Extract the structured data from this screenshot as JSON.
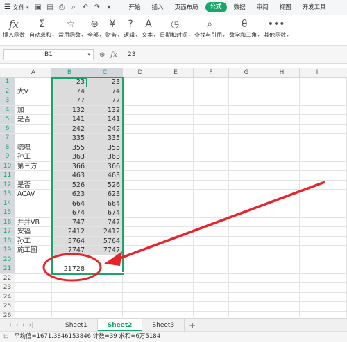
{
  "menubar": {
    "file_label": "文件",
    "tabs": [
      "开始",
      "插入",
      "页面布局",
      "公式",
      "数据",
      "审阅",
      "视图",
      "开发工具"
    ],
    "active_tab": "公式"
  },
  "ribbon": [
    {
      "icon": "fx",
      "label": "插入函数",
      "has_dropdown": false
    },
    {
      "icon": "Σ",
      "label": "自动求和",
      "has_dropdown": true
    },
    {
      "icon": "☆",
      "label": "常用函数",
      "has_dropdown": true
    },
    {
      "icon": "⊛",
      "label": "全部",
      "has_dropdown": true
    },
    {
      "icon": "¥",
      "label": "财务",
      "has_dropdown": true
    },
    {
      "icon": "?",
      "label": "逻辑",
      "has_dropdown": true
    },
    {
      "icon": "A",
      "label": "文本",
      "has_dropdown": true
    },
    {
      "icon": "◷",
      "label": "日期和时间",
      "has_dropdown": true
    },
    {
      "icon": "⌕",
      "label": "查找与引用",
      "has_dropdown": true
    },
    {
      "icon": "θ",
      "label": "数学和三角",
      "has_dropdown": true
    },
    {
      "icon": "•••",
      "label": "其他函数",
      "has_dropdown": true
    }
  ],
  "formula_bar": {
    "name_box": "B1",
    "fx_label": "fx",
    "content": "23"
  },
  "columns": [
    "A",
    "B",
    "C",
    "D",
    "E",
    "F",
    "G",
    "H",
    "I"
  ],
  "selected_columns": [
    "B",
    "C"
  ],
  "rows": [
    {
      "n": "1",
      "a": "",
      "b": "23",
      "c": "23"
    },
    {
      "n": "2",
      "a": "大V",
      "b": "74",
      "c": "74"
    },
    {
      "n": "3",
      "a": "",
      "b": "77",
      "c": "77"
    },
    {
      "n": "4",
      "a": "加",
      "b": "132",
      "c": "132"
    },
    {
      "n": "5",
      "a": "是否",
      "b": "141",
      "c": "141"
    },
    {
      "n": "6",
      "a": "",
      "b": "242",
      "c": "242"
    },
    {
      "n": "7",
      "a": "",
      "b": "335",
      "c": "335"
    },
    {
      "n": "8",
      "a": "嗯嗯",
      "b": "355",
      "c": "355"
    },
    {
      "n": "9",
      "a": "孙工",
      "b": "363",
      "c": "363"
    },
    {
      "n": "10",
      "a": "第三方",
      "b": "366",
      "c": "366"
    },
    {
      "n": "11",
      "a": "",
      "b": "463",
      "c": "463"
    },
    {
      "n": "12",
      "a": "是否",
      "b": "526",
      "c": "526"
    },
    {
      "n": "13",
      "a": "ACAV",
      "b": "623",
      "c": "623"
    },
    {
      "n": "14",
      "a": "",
      "b": "664",
      "c": "664"
    },
    {
      "n": "15",
      "a": "",
      "b": "674",
      "c": "674"
    },
    {
      "n": "16",
      "a": "并并VB",
      "b": "747",
      "c": "747"
    },
    {
      "n": "17",
      "a": "安福",
      "b": "2412",
      "c": "2412"
    },
    {
      "n": "18",
      "a": "孙工",
      "b": "5764",
      "c": "5764"
    },
    {
      "n": "19",
      "a": "施工图",
      "b": "7747",
      "c": "7747"
    },
    {
      "n": "20",
      "a": "",
      "b": "",
      "c": ""
    },
    {
      "n": "21",
      "a": "",
      "b": "21728",
      "c": ""
    },
    {
      "n": "22",
      "a": "",
      "b": "",
      "c": ""
    },
    {
      "n": "23",
      "a": "",
      "b": "",
      "c": ""
    },
    {
      "n": "24",
      "a": "",
      "b": "",
      "c": ""
    },
    {
      "n": "25",
      "a": "",
      "b": "",
      "c": ""
    },
    {
      "n": "26",
      "a": "",
      "b": "",
      "c": ""
    }
  ],
  "sheets": [
    "Sheet1",
    "Sheet2",
    "Sheet3"
  ],
  "active_sheet": "Sheet2",
  "statusbar": {
    "text": "平均值=1671.3846153846  计数=39  求和=6万5184"
  },
  "colors": {
    "accent": "#1aa56b",
    "annotation": "#e8242b"
  }
}
